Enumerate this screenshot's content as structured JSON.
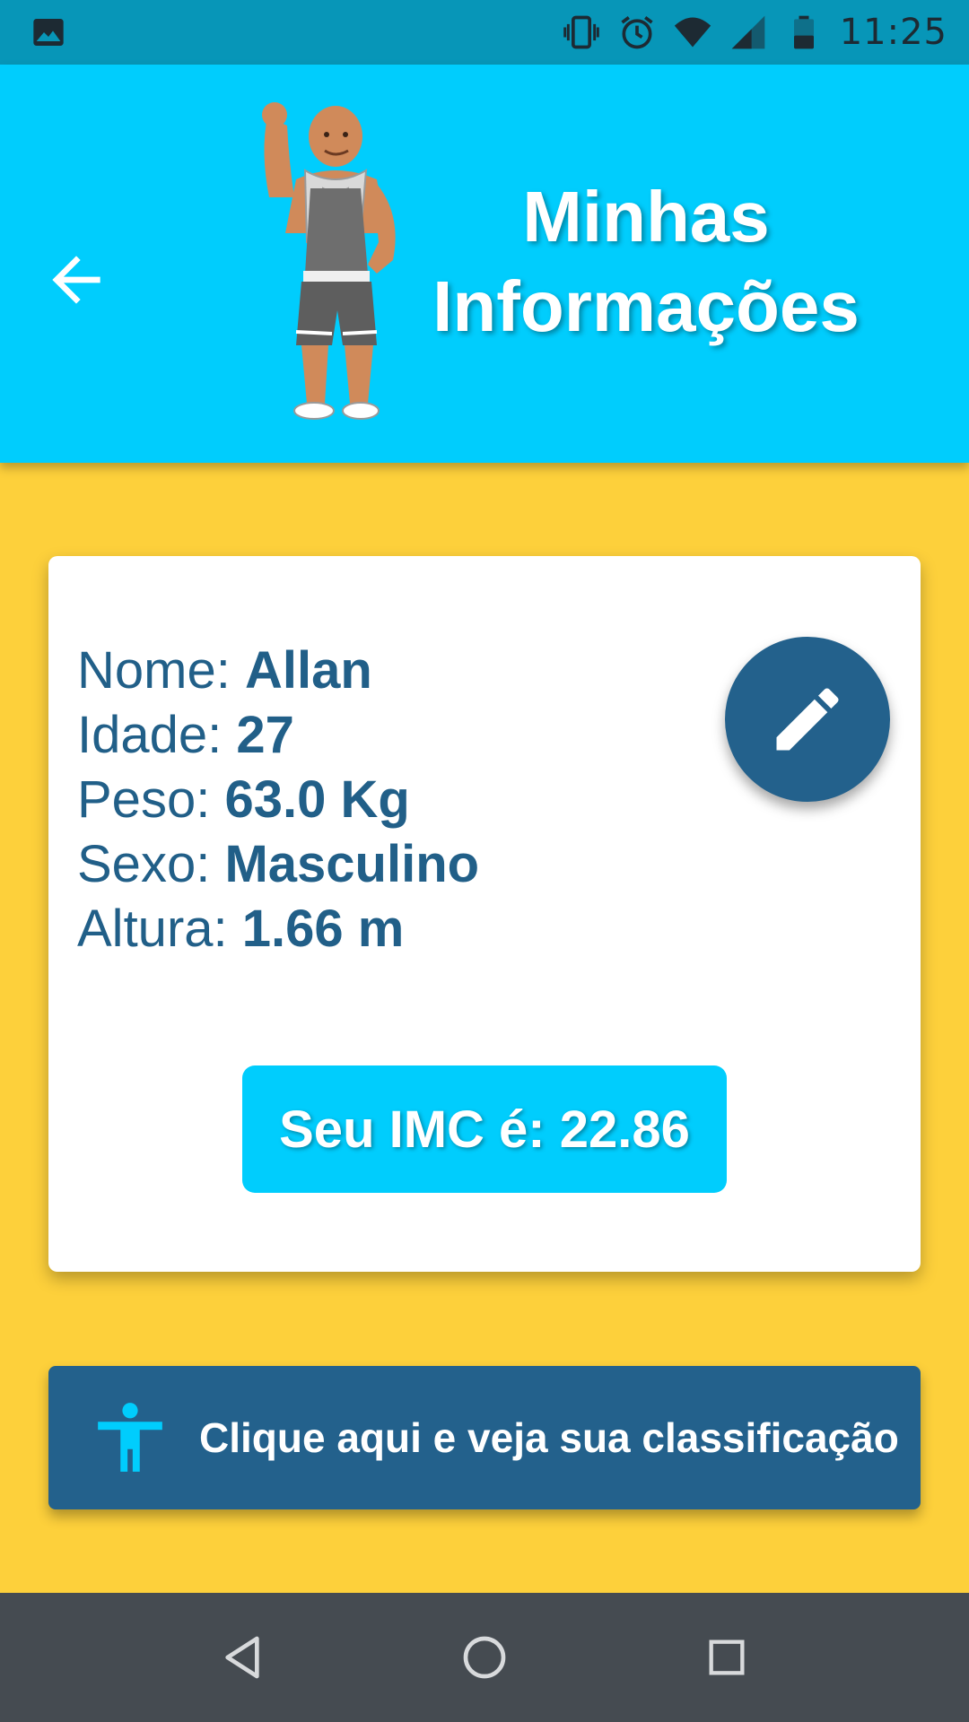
{
  "status_bar": {
    "time": "11:25",
    "icons": [
      "image-icon",
      "vibrate-icon",
      "alarm-icon",
      "wifi-icon",
      "signal-icon",
      "battery-icon"
    ]
  },
  "header": {
    "title_line1": "Minhas",
    "title_line2": "Informações",
    "back_icon": "arrow-back-icon",
    "mascot": "muscle-man-illustration"
  },
  "profile": {
    "name_label": "Nome:",
    "name_value": "Allan",
    "age_label": "Idade:",
    "age_value": "27",
    "weight_label": "Peso:",
    "weight_value": "63.0 Kg",
    "sex_label": "Sexo:",
    "sex_value": "Masculino",
    "height_label": "Altura:",
    "height_value": "1.66 m",
    "edit_icon": "pencil-icon"
  },
  "imc": {
    "label": "Seu IMC é: 22.86"
  },
  "classification_button": {
    "label": "Clique aqui e veja sua classificação",
    "icon": "accessibility-icon"
  },
  "nav_bar": {
    "icons": [
      "back-triangle-icon",
      "home-circle-icon",
      "recents-square-icon"
    ]
  },
  "colors": {
    "status_bar": "#0796b8",
    "header": "#00cdfd",
    "background": "#fdd03b",
    "primary_dark": "#23618c",
    "accent": "#00cdfd",
    "nav_bar": "#454b51"
  }
}
